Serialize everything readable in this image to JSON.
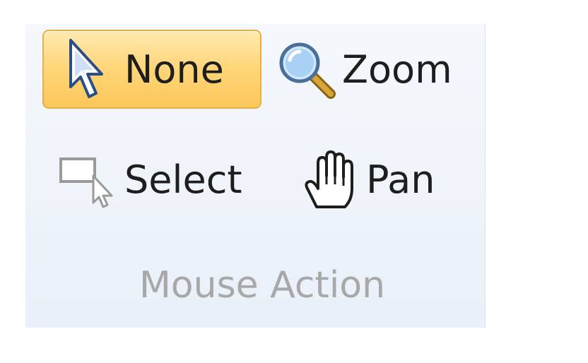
{
  "mouse_action_group": {
    "title": "Mouse Action",
    "buttons": {
      "none": {
        "label": "None",
        "icon": "arrow-pointer-icon",
        "selected": true
      },
      "zoom": {
        "label": "Zoom",
        "icon": "magnifier-icon",
        "selected": false
      },
      "select": {
        "label": "Select",
        "icon": "selection-rectangle-icon",
        "selected": false
      },
      "pan": {
        "label": "Pan",
        "icon": "hand-icon",
        "selected": false
      }
    }
  },
  "colors": {
    "selected_background": "#fcc75a",
    "selected_border": "#e4b04a",
    "group_label": "#a8a8a8"
  }
}
